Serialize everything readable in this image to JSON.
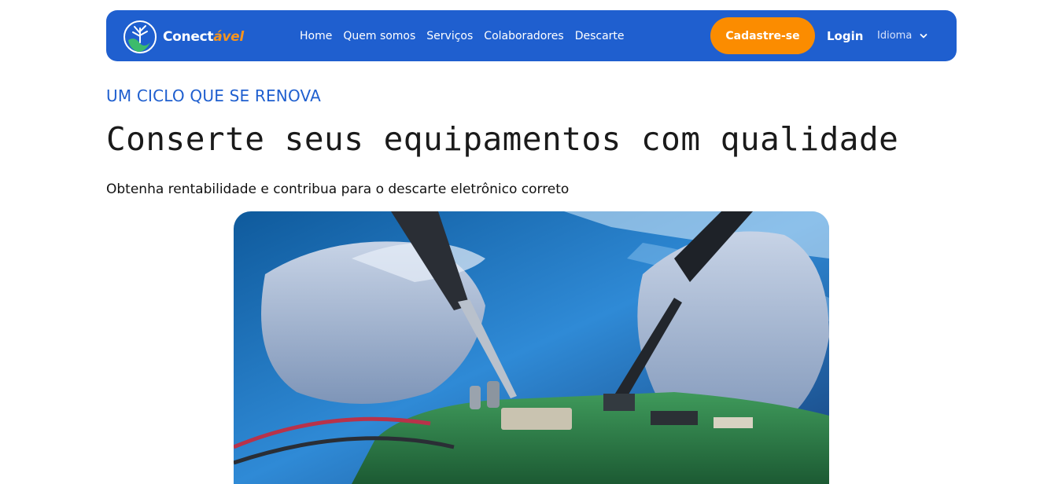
{
  "brand": {
    "name_prefix": "Conect",
    "name_accent": "ável",
    "logo_icon": "globe-tree-icon"
  },
  "nav": {
    "links": [
      "Home",
      "Quem somos",
      "Serviços",
      "Colaboradores",
      "Descarte"
    ],
    "signup_label": "Cadastre-se",
    "login_label": "Login",
    "language_label": "Idioma"
  },
  "hero": {
    "eyebrow": "UM CICLO QUE SE RENOVA",
    "title": "Conserte seus equipamentos com qualidade",
    "subtitle": "Obtenha rentabilidade e contribua para o descarte eletrônico correto",
    "image": "photo of hands soldering a green electronic circuit board"
  },
  "colors": {
    "primary": "#1f5fcf",
    "accent": "#fb8c00",
    "text": "#111111"
  }
}
